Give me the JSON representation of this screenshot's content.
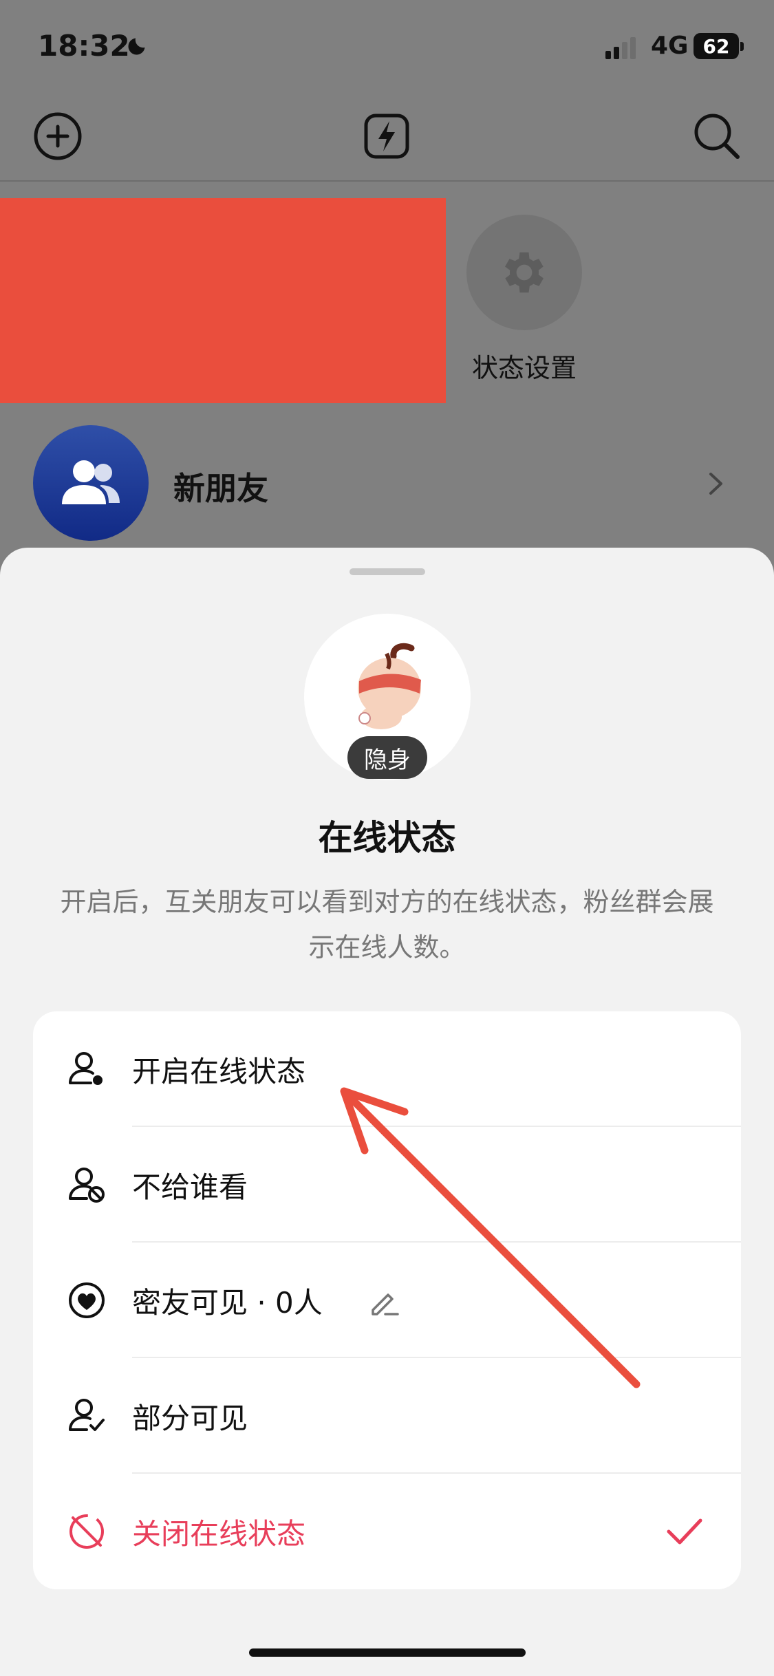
{
  "status_bar": {
    "time": "18:32",
    "network": "4G",
    "battery": "62"
  },
  "top_bar": {
    "add_icon": "plus-circle-icon",
    "flash_icon": "lightning-icon",
    "search_icon": "search-icon"
  },
  "header": {
    "settings_label": "状态设置",
    "new_friends_label": "新朋友"
  },
  "sheet": {
    "avatar_badge": "隐身",
    "title": "在线状态",
    "description": "开启后，互关朋友可以看到对方的在线状态，粉丝群会展示在线人数。",
    "options": [
      {
        "label": "开启在线状态",
        "icon": "user-dot-icon"
      },
      {
        "label": "不给谁看",
        "icon": "user-block-icon"
      },
      {
        "label": "密友可见 · 0人",
        "icon": "heart-icon"
      },
      {
        "label": "部分可见",
        "icon": "user-check-icon"
      },
      {
        "label": "关闭在线状态",
        "icon": "eye-off-icon",
        "selected": true
      }
    ]
  },
  "colors": {
    "accent": "#e83e5a",
    "annotation": "#ea4e3d"
  }
}
